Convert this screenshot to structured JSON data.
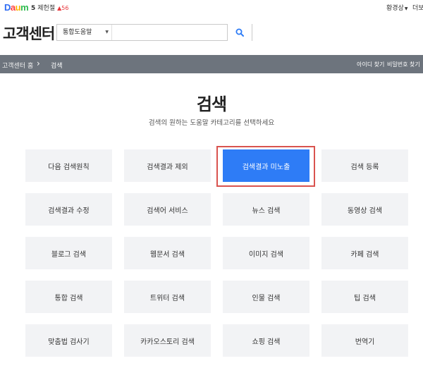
{
  "top": {
    "logo": [
      "D",
      "a",
      "u",
      "m"
    ],
    "rank_number": "5",
    "rank_text": "제헌절",
    "rank_change": "▲56",
    "user_menu": "황경상",
    "more": "더보"
  },
  "header": {
    "service_title": "고객센터",
    "search_category": "통합도움말",
    "search_value": ""
  },
  "breadcrumb": {
    "home": "고객센터 홈",
    "separator": "›",
    "current": "검색",
    "find_id": "아이디 찾기",
    "find_password": "비밀번호 찾기"
  },
  "main": {
    "title": "검색",
    "description": "검색의 원하는 도움말 카테고리를 선택하세요",
    "categories": [
      {
        "label": "다음 검색원칙"
      },
      {
        "label": "검색결과 제외"
      },
      {
        "label": "검색결과 미노출",
        "selected": true
      },
      {
        "label": "검색 등록"
      },
      {
        "label": "검색결과 수정"
      },
      {
        "label": "검색어 서비스"
      },
      {
        "label": "뉴스 검색"
      },
      {
        "label": "동영상 검색"
      },
      {
        "label": "블로그 검색"
      },
      {
        "label": "웹문서 검색"
      },
      {
        "label": "이미지 검색"
      },
      {
        "label": "카페 검색"
      },
      {
        "label": "통합 검색"
      },
      {
        "label": "트위터 검색"
      },
      {
        "label": "인물 검색"
      },
      {
        "label": "팁 검색"
      },
      {
        "label": "맞춤법 검사기"
      },
      {
        "label": "카카오스토리 검색"
      },
      {
        "label": "쇼핑 검색"
      },
      {
        "label": "번역기"
      }
    ]
  },
  "colors": {
    "accent": "#2e7cf6",
    "breadcrumb_bg": "#6d747d",
    "tile_bg": "#f2f3f5",
    "highlight_border": "#d9534f",
    "rank_up": "#e8383d"
  },
  "icons": {
    "search_button": "magnifier-icon",
    "dropdown": "caret-down-icon"
  }
}
